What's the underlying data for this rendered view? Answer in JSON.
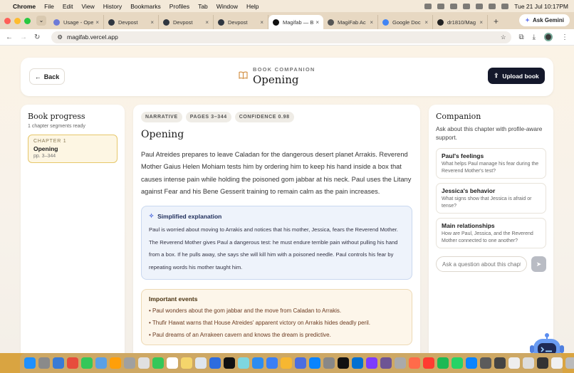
{
  "menubar": {
    "app": "Chrome",
    "items": [
      "File",
      "Edit",
      "View",
      "History",
      "Bookmarks",
      "Profiles",
      "Tab",
      "Window",
      "Help"
    ],
    "clock": "Tue 21 Jul  10:17PM"
  },
  "tabs": [
    {
      "title": "Usage - Ope",
      "color": "#6d7ad8"
    },
    {
      "title": "Devpost",
      "color": "#2f3640"
    },
    {
      "title": "Devpost",
      "color": "#2f3640"
    },
    {
      "title": "Devpost",
      "color": "#2f3640"
    },
    {
      "title": "Magifab — B",
      "color": "#111111",
      "active": true
    },
    {
      "title": "MagiFab Ac",
      "color": "#555555"
    },
    {
      "title": "Google Doc",
      "color": "#4285f4"
    },
    {
      "title": "dr1810/Mag",
      "color": "#222222"
    }
  ],
  "browser": {
    "url": "magifab.vercel.app",
    "gemini_label": "Ask Gemini"
  },
  "header": {
    "back_label": "Back",
    "kicker": "BOOK COMPANION",
    "title": "Opening",
    "upload_label": "Upload book"
  },
  "progress": {
    "title": "Book progress",
    "subtitle": "1 chapter segments ready",
    "chapter": {
      "kicker": "CHAPTER 1",
      "title": "Opening",
      "pages": "pp. 3–344"
    }
  },
  "main": {
    "tags": [
      "NARRATIVE",
      "PAGES 3–344",
      "CONFIDENCE 0.98"
    ],
    "title": "Opening",
    "summary": "Paul Atreides prepares to leave Caladan for the dangerous desert planet Arrakis. Reverend Mother Gaius Helen Mohiam tests him by ordering him to keep his hand inside a box that causes intense pain while holding the poisoned gom jabbar at his neck. Paul uses the Litany against Fear and his Bene Gesserit training to remain calm as the pain increases.",
    "simplified": {
      "heading": "Simplified explanation",
      "body": "Paul is worried about moving to Arrakis and notices that his mother, Jessica, fears the Reverend Mother. The Reverend Mother gives Paul a dangerous test: he must endure terrible pain without pulling his hand from a box. If he pulls away, she says she will kill him with a poisoned needle. Paul controls his fear by repeating words his mother taught him."
    },
    "events": {
      "heading": "Important events",
      "items": [
        "• Paul wonders about the gom jabbar and the move from Caladan to Arrakis.",
        "• Thufir Hawat warns that House Atreides' apparent victory on Arrakis hides deadly peril.",
        "• Paul dreams of an Arrakeen cavern and knows the dream is predictive."
      ]
    }
  },
  "companion": {
    "title": "Companion",
    "subtitle": "Ask about this chapter with profile-aware support.",
    "suggestions": [
      {
        "title": "Paul's feelings",
        "body": "What helps Paul manage his fear during the Reverend Mother's test?"
      },
      {
        "title": "Jessica's behavior",
        "body": "What signs show that Jessica is afraid or tense?"
      },
      {
        "title": "Main relationships",
        "body": "How are Paul, Jessica, and the Reverend Mother connected to one another?"
      }
    ],
    "input_placeholder": "Ask a question about this chapter"
  },
  "colors": {
    "accent_dark": "#14182b",
    "chapter_highlight": "#e6c76a",
    "simplified_bg": "#eef3fb",
    "events_bg": "#fdf6ea",
    "events_text": "#6b3a20"
  },
  "dock": [
    "#1e90ff",
    "#8a8a8a",
    "#3a7bd5",
    "#e74c3c",
    "#34c759",
    "#5aa0e6",
    "#ff9f0a",
    "#a0a0a0",
    "#e0e0e0",
    "#34c759",
    "#ffffff",
    "#f5d56b",
    "#dfe6ee",
    "#2d6cdf",
    "#111111",
    "#7ed6df",
    "#2d8cf0",
    "#3a7ff6",
    "#f7b731",
    "#4a6ee0",
    "#0a84ff",
    "#888888",
    "#111111",
    "#0070d1",
    "#7d3cff",
    "#6e5494",
    "#aaaaaa",
    "#ff6b4a",
    "#ff3b30",
    "#1db954",
    "#25d366",
    "#0a84ff",
    "#5b5b5b",
    "#444444",
    "#eeeeee",
    "#dddddd",
    "#333333",
    "#f0f0f0",
    "#bbbbbb"
  ]
}
